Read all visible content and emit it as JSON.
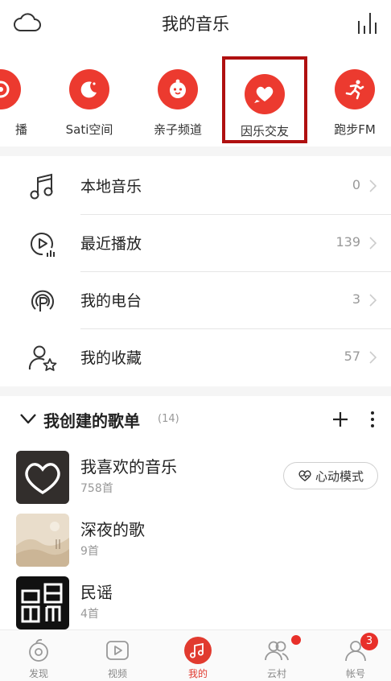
{
  "header": {
    "title": "我的音乐",
    "left_icon": "cloud-icon",
    "right_icon": "equalizer-icon"
  },
  "shortcuts": [
    {
      "label": "播",
      "icon": "radio-icon"
    },
    {
      "label": "Sati空间",
      "icon": "moon-icon"
    },
    {
      "label": "亲子频道",
      "icon": "baby-face-icon"
    },
    {
      "label": "因乐交友",
      "icon": "heart-chat-icon"
    },
    {
      "label": "跑步FM",
      "icon": "running-icon"
    }
  ],
  "menu": [
    {
      "label": "本地音乐",
      "count": "0",
      "icon": "music-note-icon"
    },
    {
      "label": "最近播放",
      "count": "139",
      "icon": "recent-play-icon"
    },
    {
      "label": "我的电台",
      "count": "3",
      "icon": "radio-station-icon"
    },
    {
      "label": "我的收藏",
      "count": "57",
      "icon": "user-star-icon"
    }
  ],
  "playlists_section": {
    "title": "我创建的歌单",
    "count": "(14)"
  },
  "playlists": [
    {
      "name": "我喜欢的音乐",
      "sub": "758首",
      "action": "心动模式"
    },
    {
      "name": "深夜的歌",
      "sub": "9首"
    },
    {
      "name": "民谣",
      "sub": "4首"
    }
  ],
  "tabs": [
    {
      "label": "发现",
      "icon": "discover-icon"
    },
    {
      "label": "视频",
      "icon": "video-icon"
    },
    {
      "label": "我的",
      "icon": "my-music-icon",
      "active": true
    },
    {
      "label": "云村",
      "icon": "friends-icon"
    },
    {
      "label": "帐号",
      "icon": "account-icon",
      "badge": "3"
    }
  ],
  "colors": {
    "accent": "#ec3a2f",
    "highlight_border": "#b01010"
  }
}
